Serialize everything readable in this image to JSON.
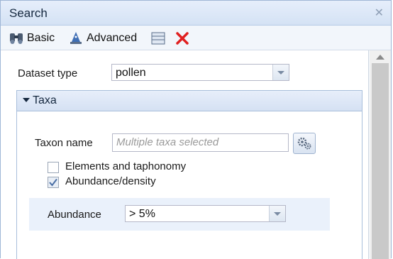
{
  "window": {
    "title": "Search"
  },
  "toolbar": {
    "basic_label": "Basic",
    "advanced_label": "Advanced"
  },
  "dataset": {
    "label": "Dataset type",
    "value": "pollen"
  },
  "taxa_panel": {
    "title": "Taxa",
    "taxon_label": "Taxon name",
    "taxon_placeholder": "Multiple taxa selected",
    "elements_label": "Elements and taphonomy",
    "elements_checked": false,
    "abundance_density_label": "Abundance/density",
    "abundance_density_checked": true,
    "abundance_label": "Abundance",
    "abundance_value": "> 5%"
  },
  "icons": {
    "close": "close-icon",
    "basic": "binoculars-icon",
    "advanced": "wizard-icon",
    "list": "list-icon",
    "clear": "red-x-icon",
    "gear": "gears-icon",
    "checkmark": "checkmark-icon"
  },
  "colors": {
    "clear_red": "#e02020",
    "accent": "#15283f"
  }
}
